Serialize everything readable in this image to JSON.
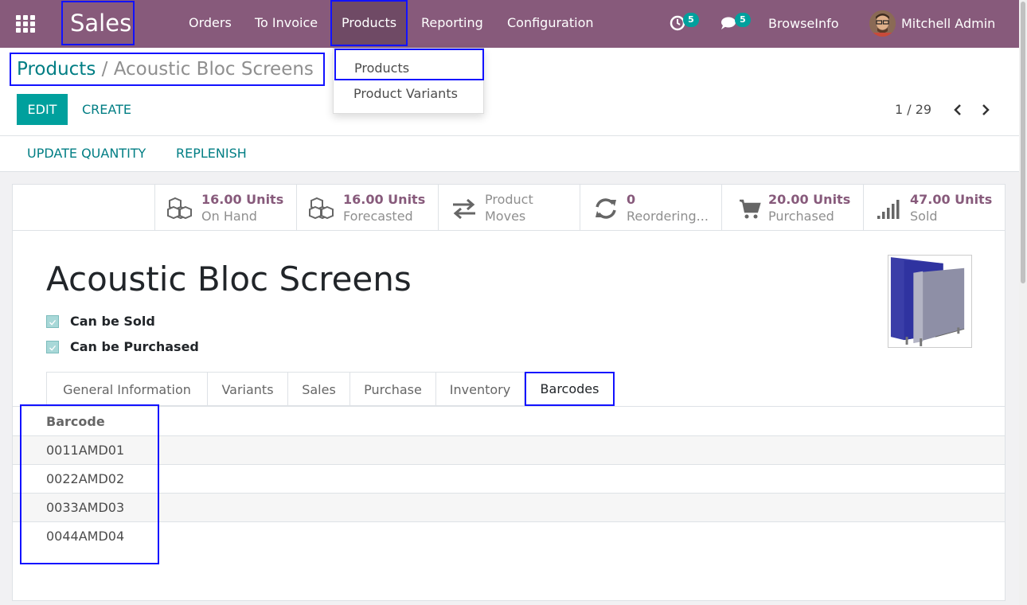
{
  "navbar": {
    "brand": "Sales",
    "menu": [
      "Orders",
      "To Invoice",
      "Products",
      "Reporting",
      "Configuration"
    ],
    "activity_count": "5",
    "message_count": "5",
    "company": "BrowseInfo",
    "user": "Mitchell Admin"
  },
  "breadcrumb": {
    "parent": "Products",
    "separator": "/",
    "current": "Acoustic Bloc Screens"
  },
  "buttons": {
    "edit": "EDIT",
    "create": "CREATE",
    "update_quantity": "UPDATE QUANTITY",
    "replenish": "REPLENISH"
  },
  "pager": {
    "value": "1 / 29"
  },
  "dropdown": {
    "items": [
      "Products",
      "Product Variants"
    ]
  },
  "smart_buttons": [
    {
      "value": "16.00 Units",
      "label": "On Hand",
      "icon": "cubes-icon"
    },
    {
      "value": "16.00 Units",
      "label": "Forecasted",
      "icon": "cubes-icon"
    },
    {
      "value": "Product",
      "label": "Moves",
      "icon": "exchange-icon"
    },
    {
      "value": "0",
      "label": "Reordering...",
      "icon": "refresh-icon"
    },
    {
      "value": "20.00 Units",
      "label": "Purchased",
      "icon": "cart-icon"
    },
    {
      "value": "47.00 Units",
      "label": "Sold",
      "icon": "signal-icon"
    }
  ],
  "product": {
    "name": "Acoustic Bloc Screens",
    "can_be_sold": "Can be Sold",
    "can_be_purchased": "Can be Purchased"
  },
  "tabs": [
    "General Information",
    "Variants",
    "Sales",
    "Purchase",
    "Inventory",
    "Barcodes"
  ],
  "barcodes": {
    "header": "Barcode",
    "rows": [
      "0011AMD01",
      "0022AMD02",
      "0033AMD03",
      "0044AMD04"
    ]
  },
  "colors": {
    "navbar": "#875a7b",
    "accent": "#00a09d",
    "link": "#017e84",
    "highlight_border": "#1212ff"
  }
}
